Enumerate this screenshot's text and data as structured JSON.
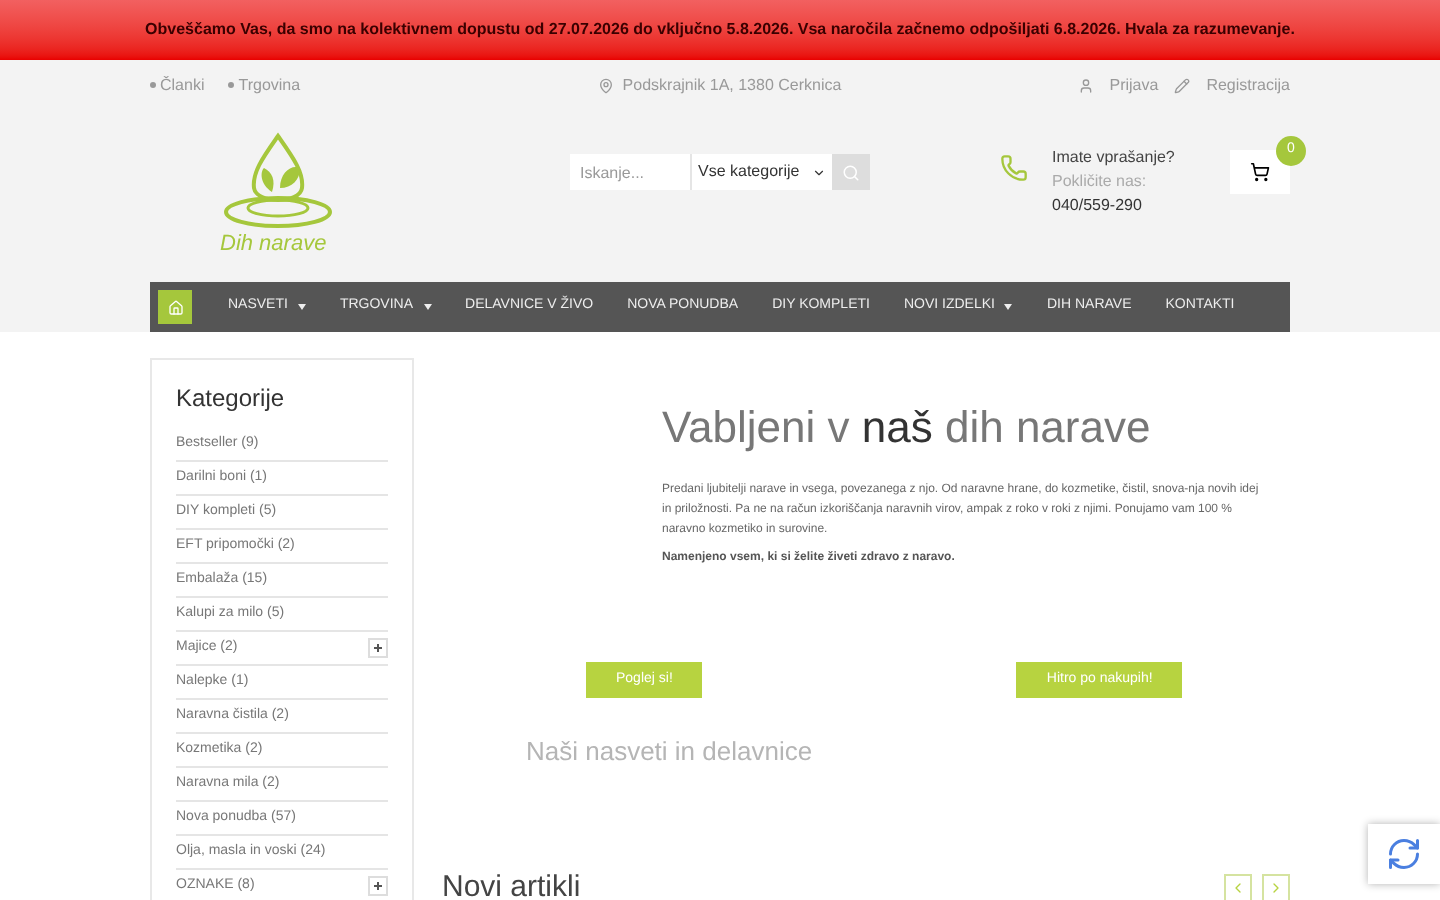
{
  "notice": "Obveščamo Vas, da smo na kolektivnem dopustu od 27.07.2026 do vključno 5.8.2026. Vsa naročila začnemo odpošiljati 6.8.2026. Hvala za razumevanje.",
  "top_bar": {
    "links": [
      "Članki",
      "Trgovina"
    ],
    "address": "Podskrajnik 1A, 1380 Cerknica",
    "login": "Prijava",
    "register": "Registracija"
  },
  "header": {
    "logo_text": "Dih narave",
    "search": {
      "placeholder": "Iskanje...",
      "category": "Vse kategorije"
    },
    "contact": {
      "question": "Imate vprašanje?",
      "call": "Pokličite nas:",
      "phone": "040/559-290"
    },
    "cart_count": "0"
  },
  "nav": {
    "home": {
      "selected": true
    },
    "items": [
      {
        "label": "NASVETI",
        "dropdown": true,
        "selected": false
      },
      {
        "label": "TRGOVINA",
        "dropdown": true,
        "selected": false
      },
      {
        "label": "DELAVNICE V ŽIVO",
        "dropdown": false,
        "selected": false
      },
      {
        "label": "NOVA PONUDBA",
        "dropdown": false,
        "selected": false
      },
      {
        "label": "DIY KOMPLETI",
        "dropdown": false,
        "selected": false
      },
      {
        "label": "NOVI IZDELKI",
        "dropdown": true,
        "selected": false
      },
      {
        "label": "DIH NARAVE",
        "dropdown": false,
        "selected": false
      },
      {
        "label": "KONTAKTI",
        "dropdown": false,
        "selected": false
      }
    ]
  },
  "sidebar": {
    "title": "Kategorije",
    "items": [
      {
        "label": "Bestseller (9)",
        "expandable": false
      },
      {
        "label": "Darilni boni (1)",
        "expandable": false
      },
      {
        "label": "DIY kompleti (5)",
        "expandable": false
      },
      {
        "label": "EFT pripomočki (2)",
        "expandable": false
      },
      {
        "label": "Embalaža (15)",
        "expandable": false
      },
      {
        "label": "Kalupi za milo (5)",
        "expandable": false
      },
      {
        "label": "Majice (2)",
        "expandable": true
      },
      {
        "label": "Nalepke (1)",
        "expandable": false
      },
      {
        "label": "Naravna čistila (2)",
        "expandable": false
      },
      {
        "label": "Kozmetika (2)",
        "expandable": false
      },
      {
        "label": "Naravna mila (2)",
        "expandable": false
      },
      {
        "label": "Nova ponudba (57)",
        "expandable": false
      },
      {
        "label": "Olja, masla in voski (24)",
        "expandable": false
      },
      {
        "label": "OZNAKE (8)",
        "expandable": true
      }
    ]
  },
  "hero": {
    "title": "Vabljeni v **naš** dih narave",
    "text": "Predani ljubitelji narave in vsega, povezanega z njo. Od naravne hrane, do kozmetike, čistil, snova-nja novih idej in priložnosti. Pa ne na račun izkoriščanja naravnih virov, ampak z roko v roki z njimi. Ponujamo vam 100 % naravno kozmetiko in surovine.",
    "tagline": "Namenjeno vsem, ki si želite živeti zdravo z naravo."
  },
  "buttons": [
    "Poglej si!",
    "Hitro po nakupih!"
  ],
  "tips_heading": "Naši nasveti in delavnice",
  "new_items": {
    "title": "Novi artikli"
  }
}
